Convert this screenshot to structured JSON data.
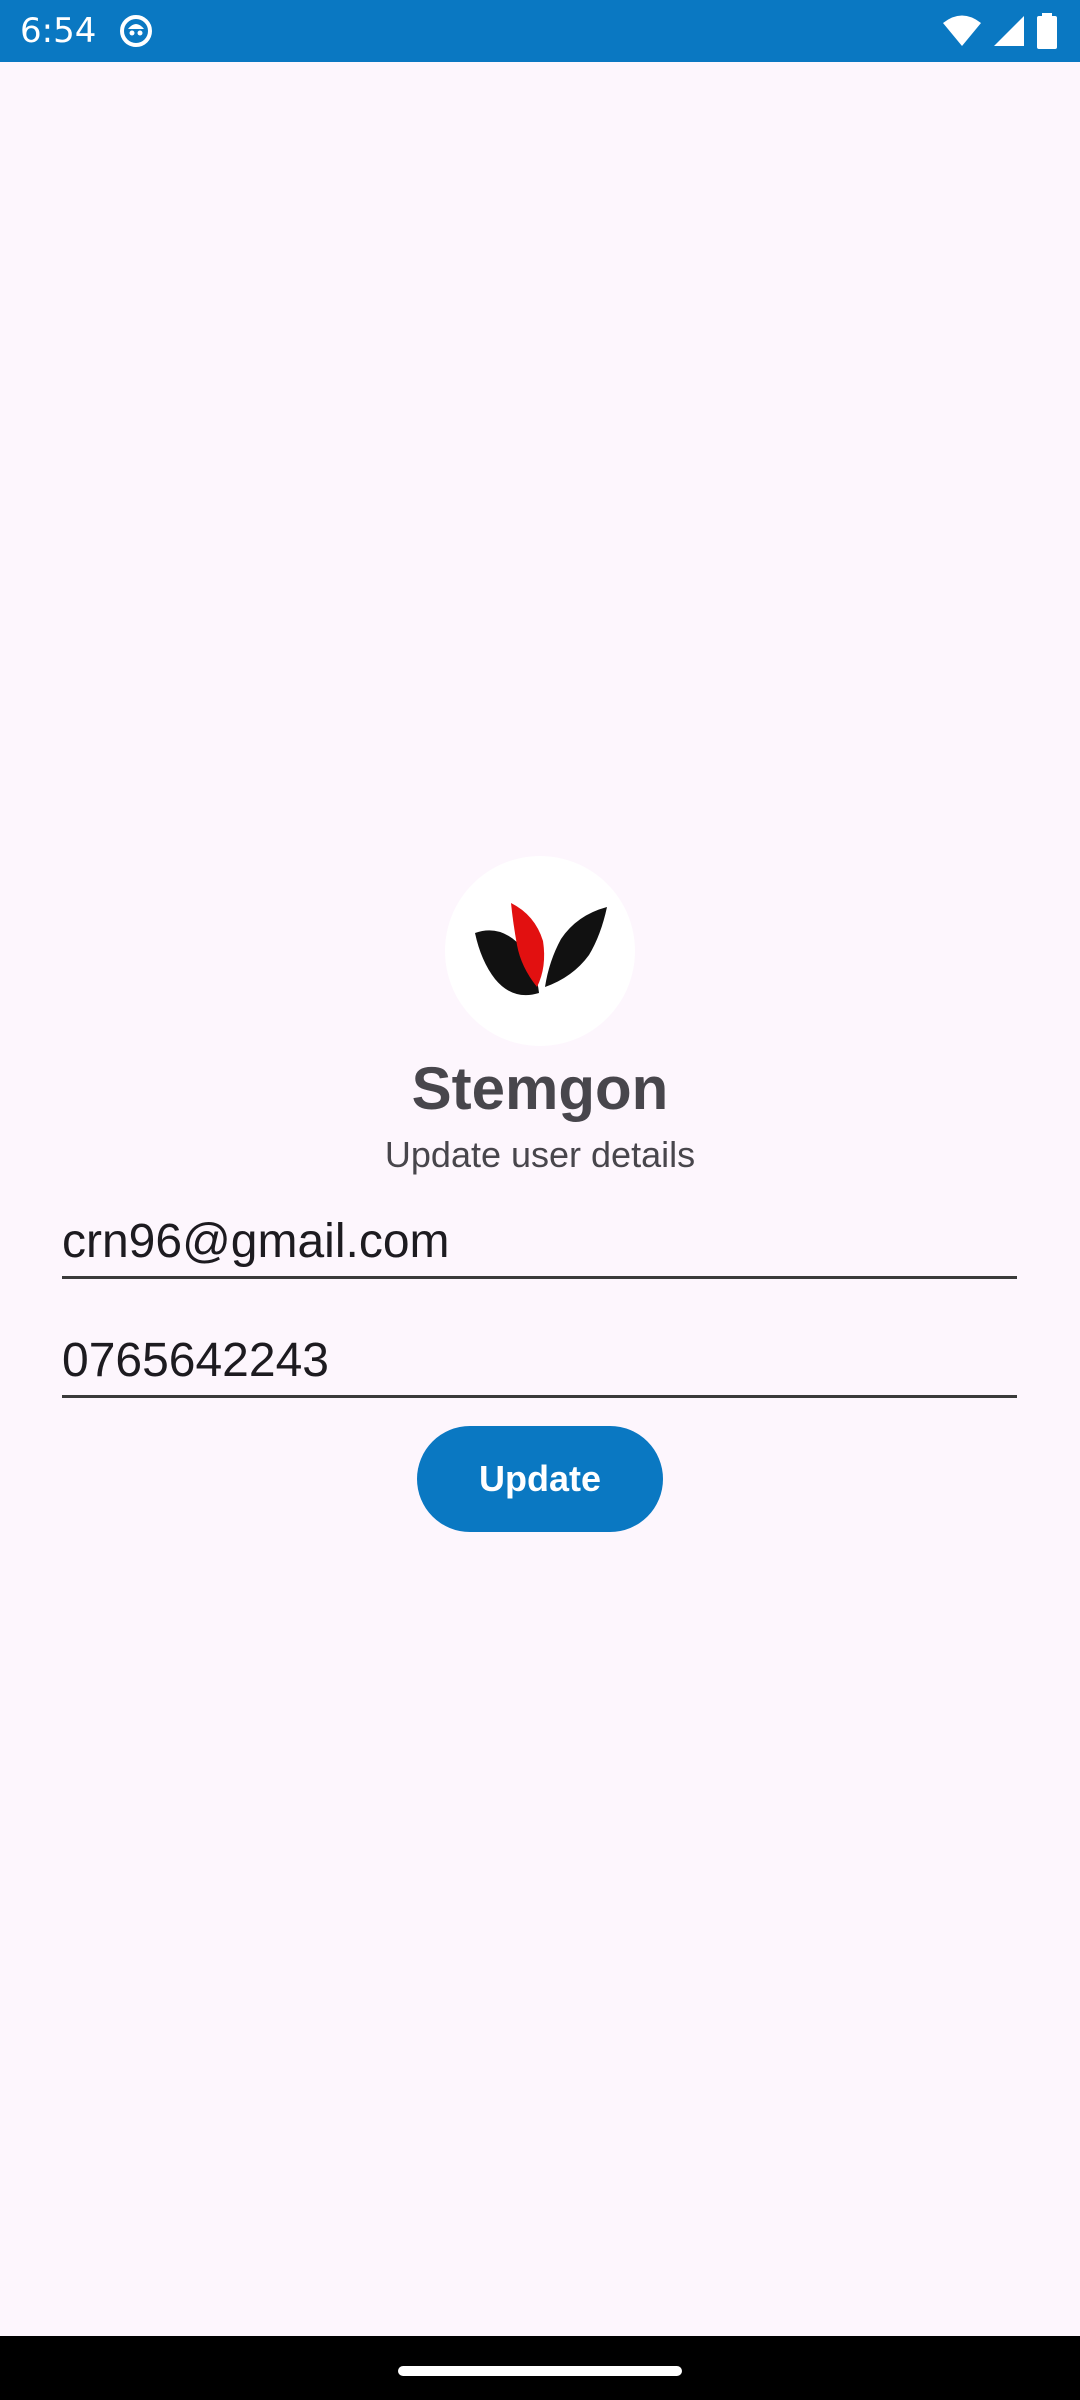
{
  "status_bar": {
    "time": "6:54",
    "background_color": "#0a78c2",
    "icons": [
      "notification-icon",
      "wifi-icon",
      "cellular-signal-icon",
      "battery-icon"
    ]
  },
  "app": {
    "logo_icon": "leaf-logo-icon",
    "name": "Stemgon",
    "subtitle": "Update user details"
  },
  "form": {
    "email_value": "crn96@gmail.com",
    "phone_value": "0765642243",
    "update_label": "Update"
  },
  "colors": {
    "accent": "#0a78c2",
    "background": "#fdf6fd",
    "text": "#48464c"
  }
}
